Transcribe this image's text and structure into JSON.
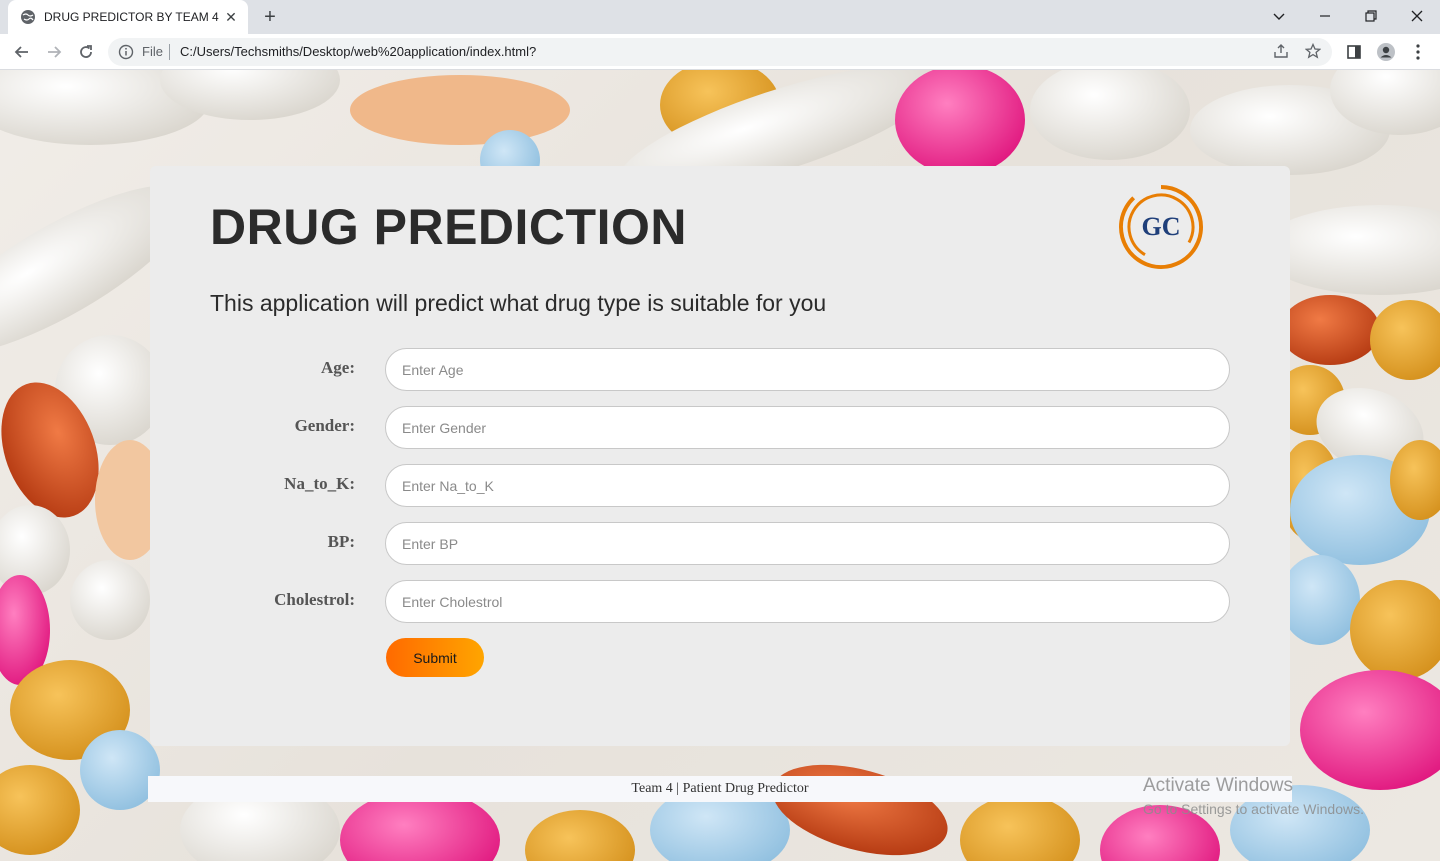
{
  "browser": {
    "tab_title": "DRUG PREDICTOR BY TEAM 4",
    "tab_close": "✕",
    "new_tab": "+",
    "scheme_label": "File",
    "url": "C:/Users/Techsmiths/Desktop/web%20application/index.html?"
  },
  "page": {
    "title": "DRUG PREDICTION",
    "logo_text": "GC",
    "subtitle": "This application will predict what drug type is suitable for you"
  },
  "form": {
    "fields": [
      {
        "label": "Age:",
        "placeholder": "Enter Age"
      },
      {
        "label": "Gender:",
        "placeholder": "Enter Gender"
      },
      {
        "label": "Na_to_K:",
        "placeholder": "Enter Na_to_K"
      },
      {
        "label": "BP:",
        "placeholder": "Enter BP"
      },
      {
        "label": "Cholestrol:",
        "placeholder": "Enter Cholestrol"
      }
    ],
    "submit_label": "Submit"
  },
  "footer": {
    "text": "Team 4 | Patient Drug Predictor"
  },
  "watermark": {
    "title": "Activate Windows",
    "subtitle": "Go to Settings to activate Windows."
  },
  "colors": {
    "accent_orange": "#ff6a00",
    "logo_orange": "#e87e04",
    "logo_navy": "#1f3f7a"
  }
}
